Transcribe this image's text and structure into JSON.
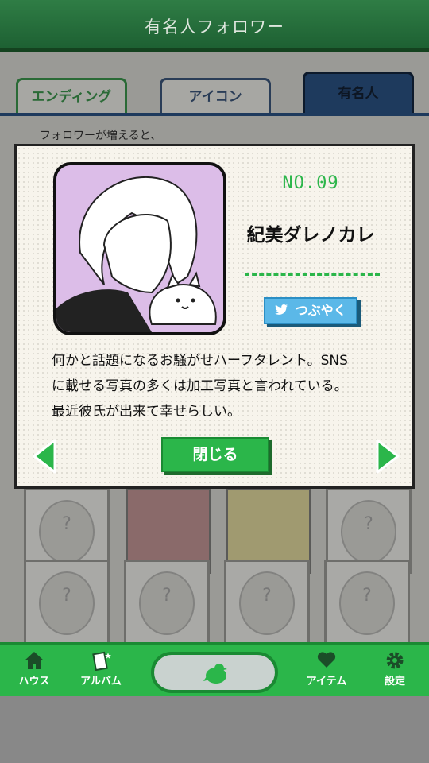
{
  "header": {
    "title": "有名人フォロワー"
  },
  "tabs": [
    {
      "label": "エンディング"
    },
    {
      "label": "アイコン"
    },
    {
      "label": "有名人"
    }
  ],
  "page": {
    "hint": "フォロワーが増えると、",
    "unknown_mark": "?"
  },
  "modal": {
    "number": "NO.09",
    "name": "紀美ダレノカレ",
    "tweet_button": "つぶやく",
    "description_lines": [
      "何かと話題になるお騒がせハーフタレント。SNS",
      "に載せる写真の多くは加工写真と言われている。",
      "最近彼氏が出来て幸せらしい。"
    ],
    "close_button": "閉じる"
  },
  "bottom_nav": {
    "house": "ハウス",
    "album": "アルバム",
    "item": "アイテム",
    "settings": "設定"
  },
  "colors": {
    "accent_green": "#2bb64a",
    "header_green": "#2f7d45",
    "active_tab": "#1e3a5d",
    "twitter_blue": "#5bb8e8",
    "avatar_bg": "#dcbde8"
  },
  "icons": [
    "home-icon",
    "album-icon",
    "bird-icon",
    "heart-icon",
    "gear-icon",
    "twitter-bird-icon",
    "arrow-left-icon",
    "arrow-right-icon"
  ]
}
